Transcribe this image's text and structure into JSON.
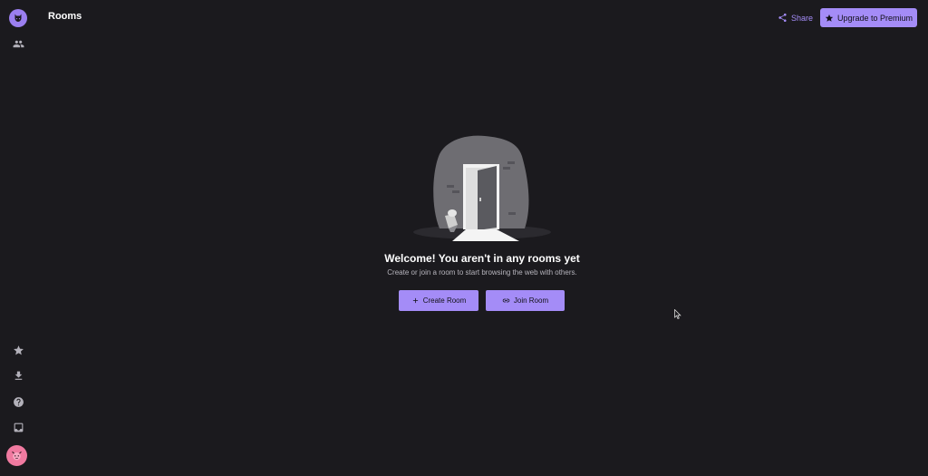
{
  "header": {
    "title": "Rooms",
    "share_label": "Share",
    "premium_label": "Upgrade to Premium"
  },
  "empty_state": {
    "heading": "Welcome! You aren't in any rooms yet",
    "subtitle": "Create or join a room to start browsing the web with others.",
    "create_label": "Create Room",
    "join_label": "Join Room"
  },
  "sidebar": {
    "top_items": [
      {
        "icon": "logo-icon"
      },
      {
        "icon": "people-icon"
      }
    ],
    "bottom_items": [
      {
        "icon": "star-icon"
      },
      {
        "icon": "download-icon"
      },
      {
        "icon": "help-icon"
      },
      {
        "icon": "inbox-icon"
      },
      {
        "icon": "avatar"
      }
    ]
  },
  "colors": {
    "background": "#1b1a1e",
    "accent": "#a48cf7",
    "logo": "#9b7ff0",
    "avatar": "#f07aa0",
    "muted_text": "#b6b4bc"
  }
}
